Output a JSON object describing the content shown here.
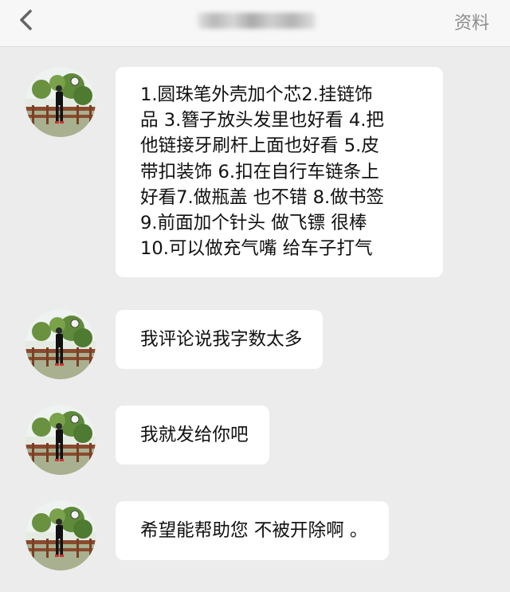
{
  "header": {
    "back_icon": "chevron-left-icon",
    "contact_name_redacted": true,
    "profile_label": "资料"
  },
  "messages": [
    {
      "sender": "contact",
      "avatar": "avatar-photo",
      "lines": [
        "1.圆珠笔外壳加个芯2.挂链饰",
        "品 3.簪子放头发里也好看 4.把",
        "他链接牙刷杆上面也好看 5.皮",
        "带扣装饰 6.扣在自行车链条上",
        "好看7.做瓶盖 也不错 8.做书签",
        "9.前面加个针头 做飞镖 很棒",
        "10.可以做充气嘴 给车子打气"
      ]
    },
    {
      "sender": "contact",
      "avatar": "avatar-photo",
      "text": "我评论说我字数太多"
    },
    {
      "sender": "contact",
      "avatar": "avatar-photo",
      "text": "我就发给你吧"
    },
    {
      "sender": "contact",
      "avatar": "avatar-photo",
      "text": "希望能帮助您 不被开除啊 。"
    }
  ],
  "colors": {
    "background": "#ececec",
    "header_background": "#f7f7f7",
    "bubble": "#ffffff",
    "text": "#111111",
    "muted": "#8d8d8d"
  }
}
